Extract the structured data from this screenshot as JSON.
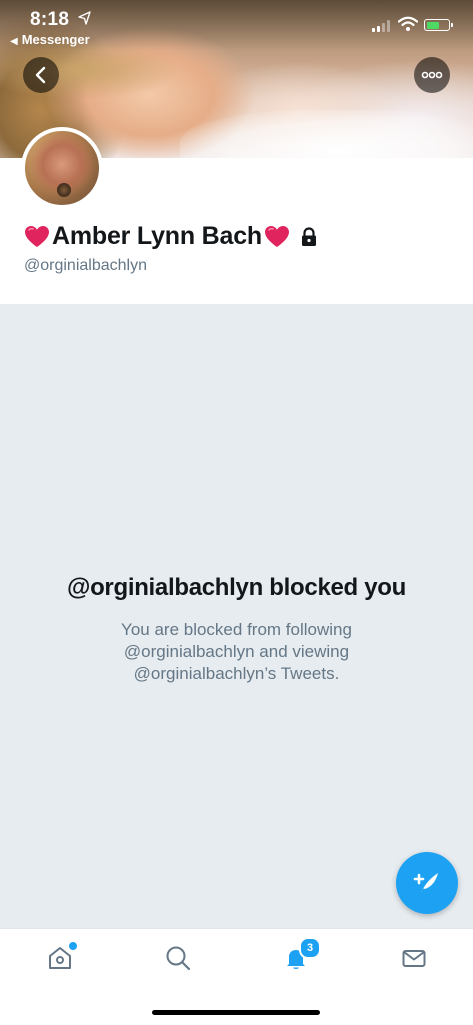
{
  "status_bar": {
    "time": "8:18",
    "back_app": "Messenger"
  },
  "profile": {
    "name": "Amber Lynn Bach",
    "handle": "@orginialbachlyn"
  },
  "blocked": {
    "title": "@orginialbachlyn blocked you",
    "message": "You are blocked from following @orginialbachlyn and viewing @orginialbachlyn’s Tweets."
  },
  "tabbar": {
    "notifications_badge": "3"
  },
  "colors": {
    "accent": "#1da1f2",
    "blocked_bg": "#e6ecf0",
    "secondary_text": "#657786",
    "heart": "#e0245e"
  },
  "icons": {
    "back": "chevron-left-icon",
    "more": "more-icon",
    "lock": "lock-icon",
    "compose": "compose-tweet-icon",
    "home": "home-icon",
    "search": "search-icon",
    "notifications": "bell-icon",
    "messages": "mail-icon"
  }
}
